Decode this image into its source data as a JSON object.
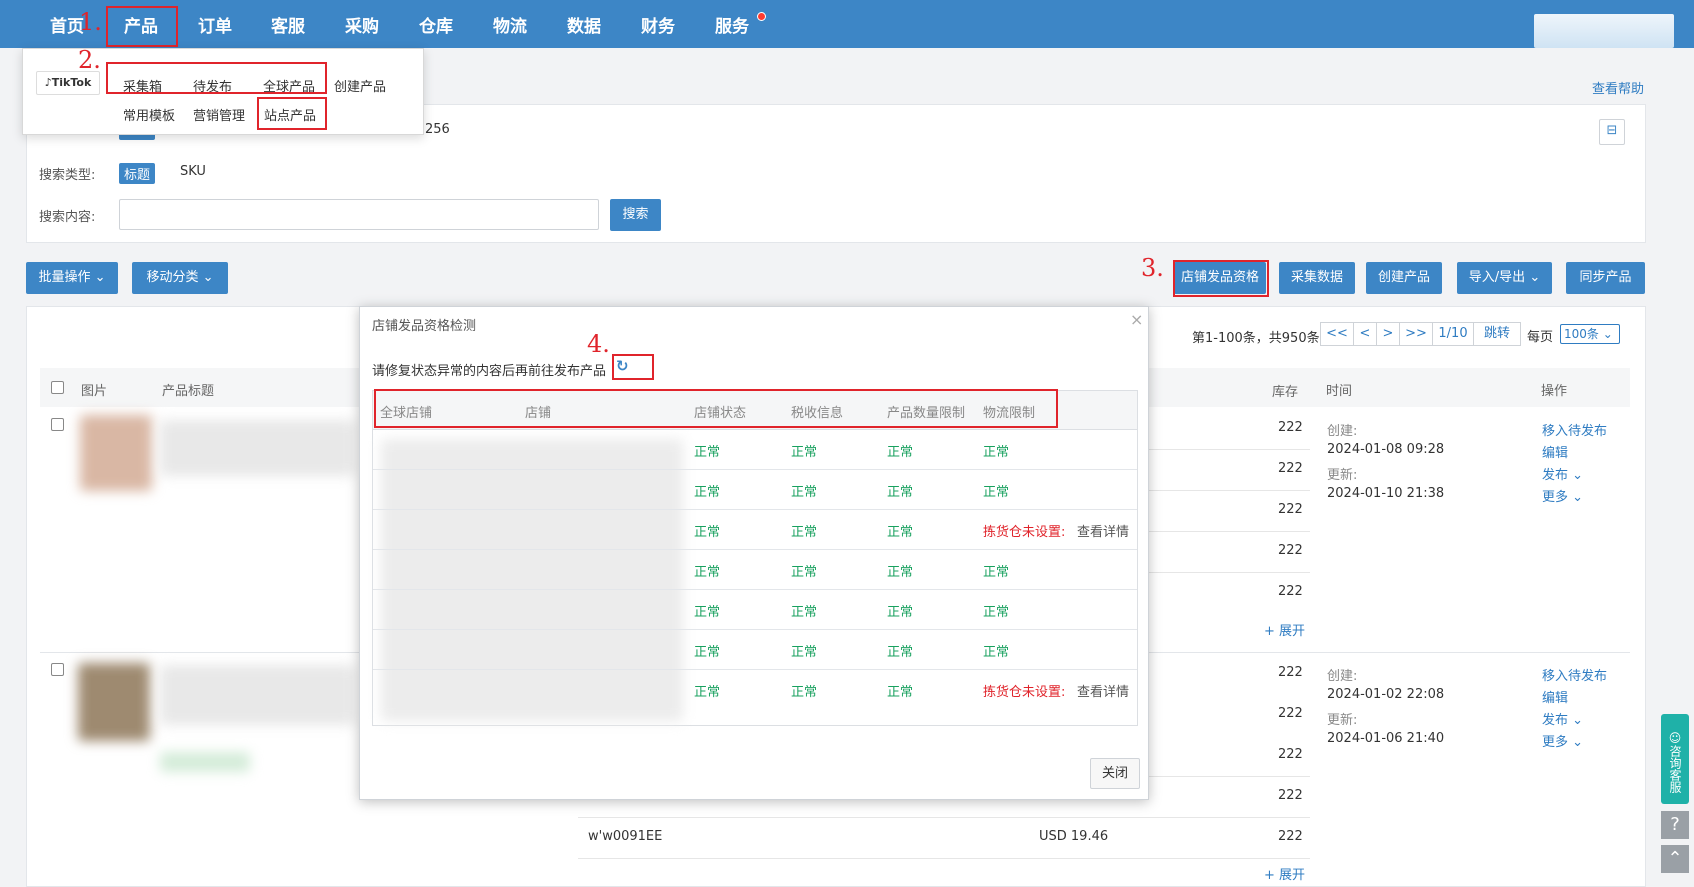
{
  "nav": {
    "items": [
      "首页",
      "产品",
      "订单",
      "客服",
      "采购",
      "仓库",
      "物流",
      "数据",
      "财务",
      "服务"
    ]
  },
  "annotations": {
    "n1": "1.",
    "n2": "2.",
    "n3": "3.",
    "n4": "4."
  },
  "dropdown": {
    "brand": "TikTok",
    "row1": [
      "采集箱",
      "待发布",
      "全球产品",
      "创建产品"
    ],
    "row2": [
      "常用模板",
      "营销管理",
      "站点产品"
    ]
  },
  "help_link": "查看帮助",
  "filter": {
    "partial_value": "256",
    "search_type_label": "搜索类型:",
    "type_title": "标题",
    "type_sku": "SKU",
    "search_content_label": "搜索内容:",
    "search_placeholder": "",
    "search_button": "搜索"
  },
  "toolbar": {
    "batch": "批量操作",
    "move": "移动分类",
    "shop_qualification": "店铺发品资格",
    "collect": "采集数据",
    "create": "创建产品",
    "import_export": "导入/导出",
    "sync": "同步产品"
  },
  "pagination": {
    "summary": "第1-100条，共950条",
    "first": "<<",
    "prev": "<",
    "next": ">",
    "last": ">>",
    "page": "1/10",
    "jump": "跳转",
    "per_page_label": "每页",
    "per_page_value": "100条"
  },
  "table": {
    "headers": {
      "image": "图片",
      "title": "产品标题",
      "stock": "库存",
      "time": "时间",
      "action": "操作"
    },
    "stock_values": [
      "222",
      "222",
      "222",
      "222",
      "222",
      "222",
      "222",
      "222",
      "222",
      "222"
    ],
    "expand": "+ 展开",
    "products": [
      {
        "created_label": "创建:",
        "created": "2024-01-08 09:28",
        "updated_label": "更新:",
        "updated": "2024-01-10 21:38"
      },
      {
        "created_label": "创建:",
        "created": "2024-01-02 22:08",
        "updated_label": "更新:",
        "updated": "2024-01-06 21:40"
      }
    ],
    "actions": {
      "move": "移入待发布",
      "edit": "编辑",
      "publish": "发布",
      "more": "更多"
    },
    "bottom_sku": "w'w0091EE",
    "bottom_price": "USD 19.46"
  },
  "modal": {
    "title": "店铺发品资格检测",
    "hint": "请修复状态异常的内容后再前往发布产品",
    "refresh_icon": "refresh-icon",
    "headers": [
      "全球店铺",
      "店铺",
      "店铺状态",
      "税收信息",
      "产品数量限制",
      "物流限制"
    ],
    "rows": [
      {
        "status": "正常",
        "tax": "正常",
        "qty": "正常",
        "logistics": "正常",
        "detail": ""
      },
      {
        "status": "正常",
        "tax": "正常",
        "qty": "正常",
        "logistics": "正常",
        "detail": ""
      },
      {
        "status": "正常",
        "tax": "正常",
        "qty": "正常",
        "logistics": "拣货仓未设置:",
        "detail": "查看详情"
      },
      {
        "status": "正常",
        "tax": "正常",
        "qty": "正常",
        "logistics": "正常",
        "detail": ""
      },
      {
        "status": "正常",
        "tax": "正常",
        "qty": "正常",
        "logistics": "正常",
        "detail": ""
      },
      {
        "status": "正常",
        "tax": "正常",
        "qty": "正常",
        "logistics": "正常",
        "detail": ""
      },
      {
        "status": "正常",
        "tax": "正常",
        "qty": "正常",
        "logistics": "拣货仓未设置:",
        "detail": "查看详情"
      }
    ],
    "close_button": "关闭"
  },
  "side": {
    "consult": "咨询客服",
    "help_icon": "question-icon",
    "top_icon": "chevron-up-icon"
  },
  "colors": {
    "primary": "#3d86c6",
    "danger": "#e0242b",
    "success": "#19a15f"
  }
}
